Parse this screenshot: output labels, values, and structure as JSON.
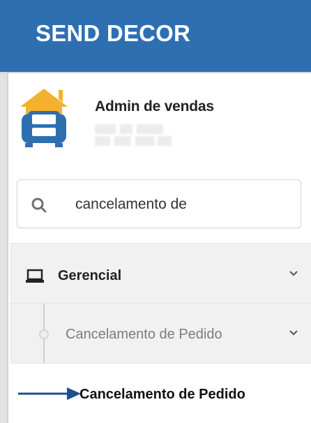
{
  "header": {
    "brand": "SEND DECOR"
  },
  "profile": {
    "name": "Admin de vendas",
    "logo_icon": "armchair-house-logo"
  },
  "search": {
    "value": "cancelamento de",
    "icon": "search-icon"
  },
  "menu": {
    "gerencial": {
      "label": "Gerencial",
      "icon": "monitor-icon"
    },
    "submenu": {
      "label": "Cancelamento de Pedido"
    },
    "item": {
      "label": "Cancelamento de Pedido"
    }
  },
  "colors": {
    "header": "#2e6fb1",
    "logo_blue": "#2e6fb1",
    "logo_yellow": "#f3b22d",
    "arrow": "#1f4f8e"
  }
}
